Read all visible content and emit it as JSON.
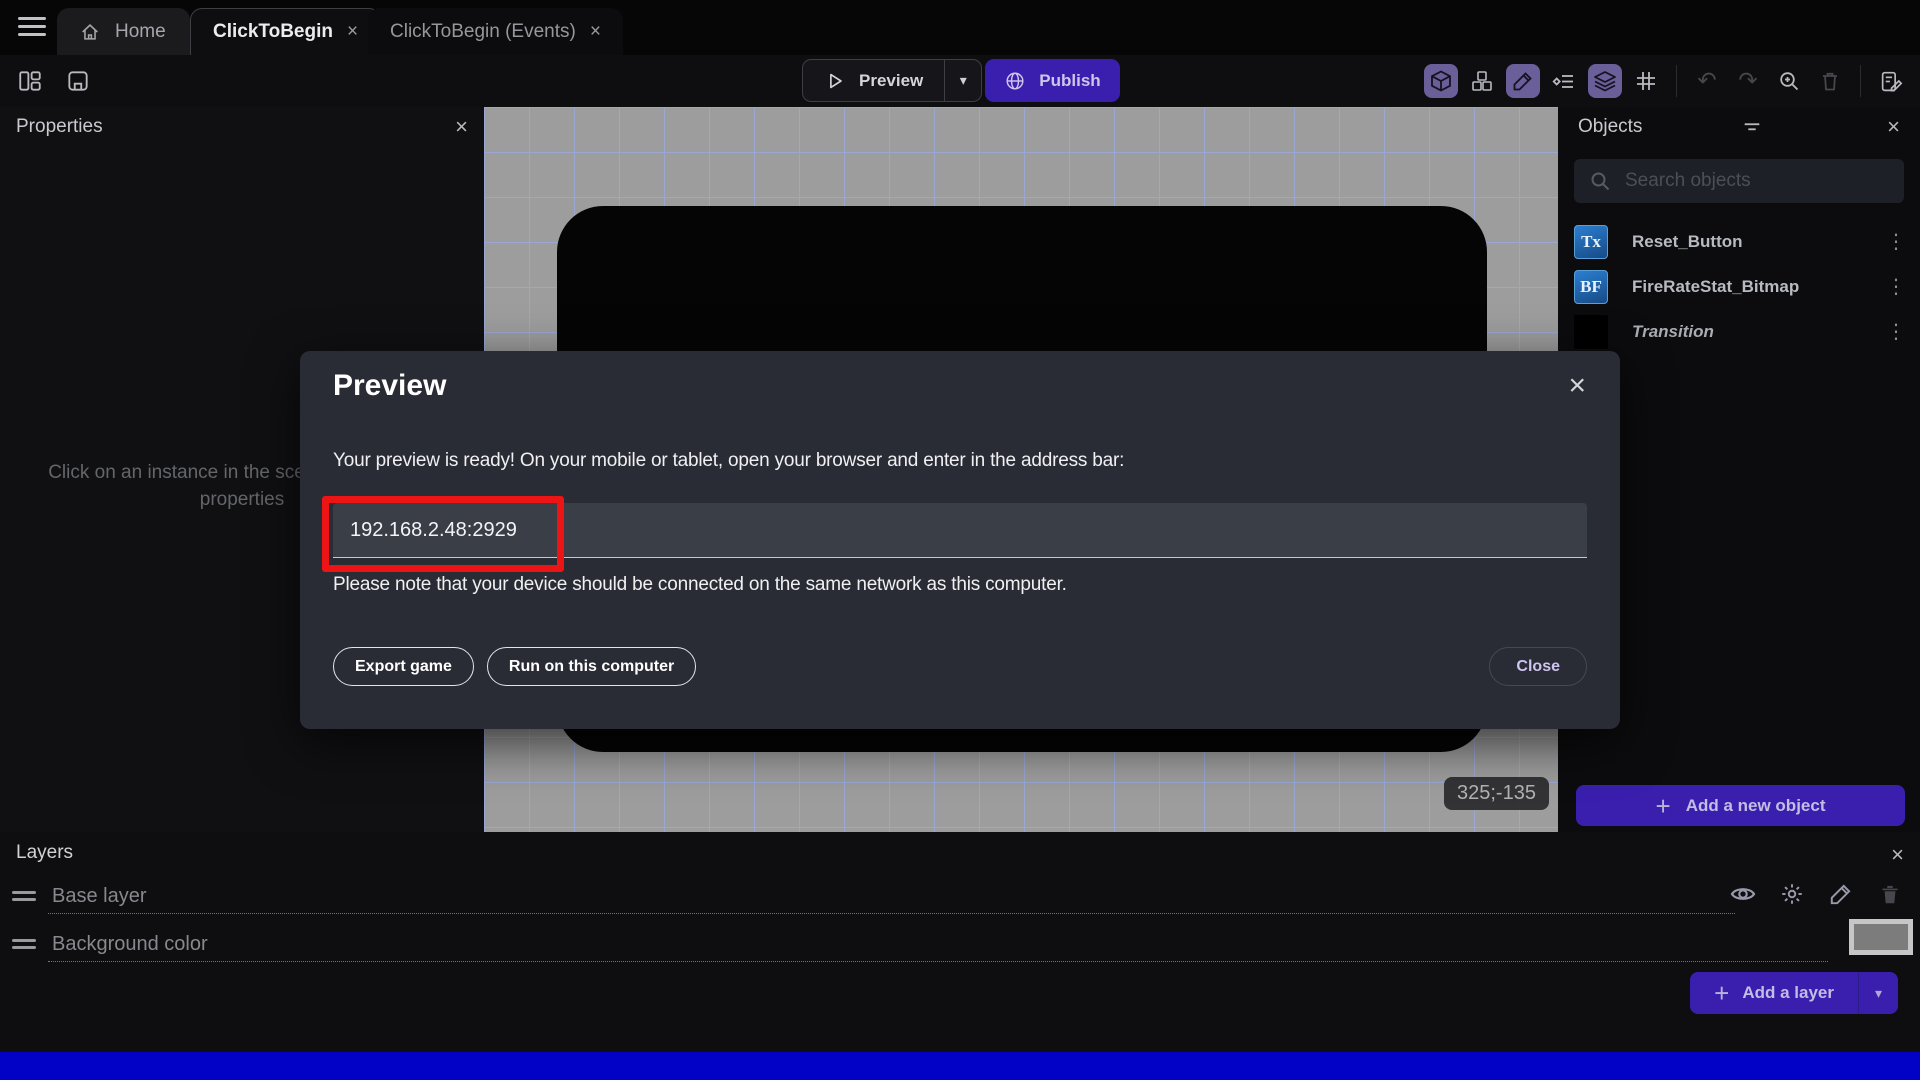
{
  "tabbar": {
    "tabs": [
      {
        "label": "Home"
      },
      {
        "label": "ClickToBegin",
        "close": "×"
      },
      {
        "label": "ClickToBegin (Events)",
        "close": "×"
      }
    ]
  },
  "toolbar": {
    "preview_label": "Preview",
    "publish_label": "Publish"
  },
  "properties": {
    "title": "Properties",
    "close": "×",
    "empty_text": "Click on an instance in the scene to display its properties"
  },
  "canvas": {
    "coordinate_badge": "325;-135"
  },
  "objects": {
    "title": "Objects",
    "close": "×",
    "search_placeholder": "Search objects",
    "items": [
      {
        "name": "Reset_Button",
        "icon_label": "Tx"
      },
      {
        "name": "FireRateStat_Bitmap",
        "icon_label": "BF"
      },
      {
        "name": "Transition",
        "icon_label": ""
      }
    ],
    "add_button": "Add a new object"
  },
  "layers": {
    "title": "Layers",
    "close": "×",
    "rows": [
      {
        "name": "Base layer"
      },
      {
        "name": "Background color"
      }
    ],
    "add_button": "Add a layer"
  },
  "dialog": {
    "title": "Preview",
    "close": "×",
    "body": "Your preview is ready! On your mobile or tablet, open your browser and enter in the address bar:",
    "address_value": "192.168.2.48:2929",
    "note": "Please note that your device should be connected on the same network as this computer.",
    "export_button": "Export game",
    "run_button": "Run on this computer",
    "close_button": "Close"
  },
  "glyphs": {
    "kebab": "⋮",
    "caret_down": "▾",
    "plus": "+",
    "undo": "↶",
    "redo": "↷"
  },
  "colors": {
    "accent_purple": "#3a1fae",
    "toolbar_active_purple": "#6b5f9a",
    "annotation_red": "#ec1414",
    "canvas_bg": "#9d9d9d",
    "grid_line": "#9aa7d2",
    "object_icon_blue": "#2b7fd0"
  }
}
